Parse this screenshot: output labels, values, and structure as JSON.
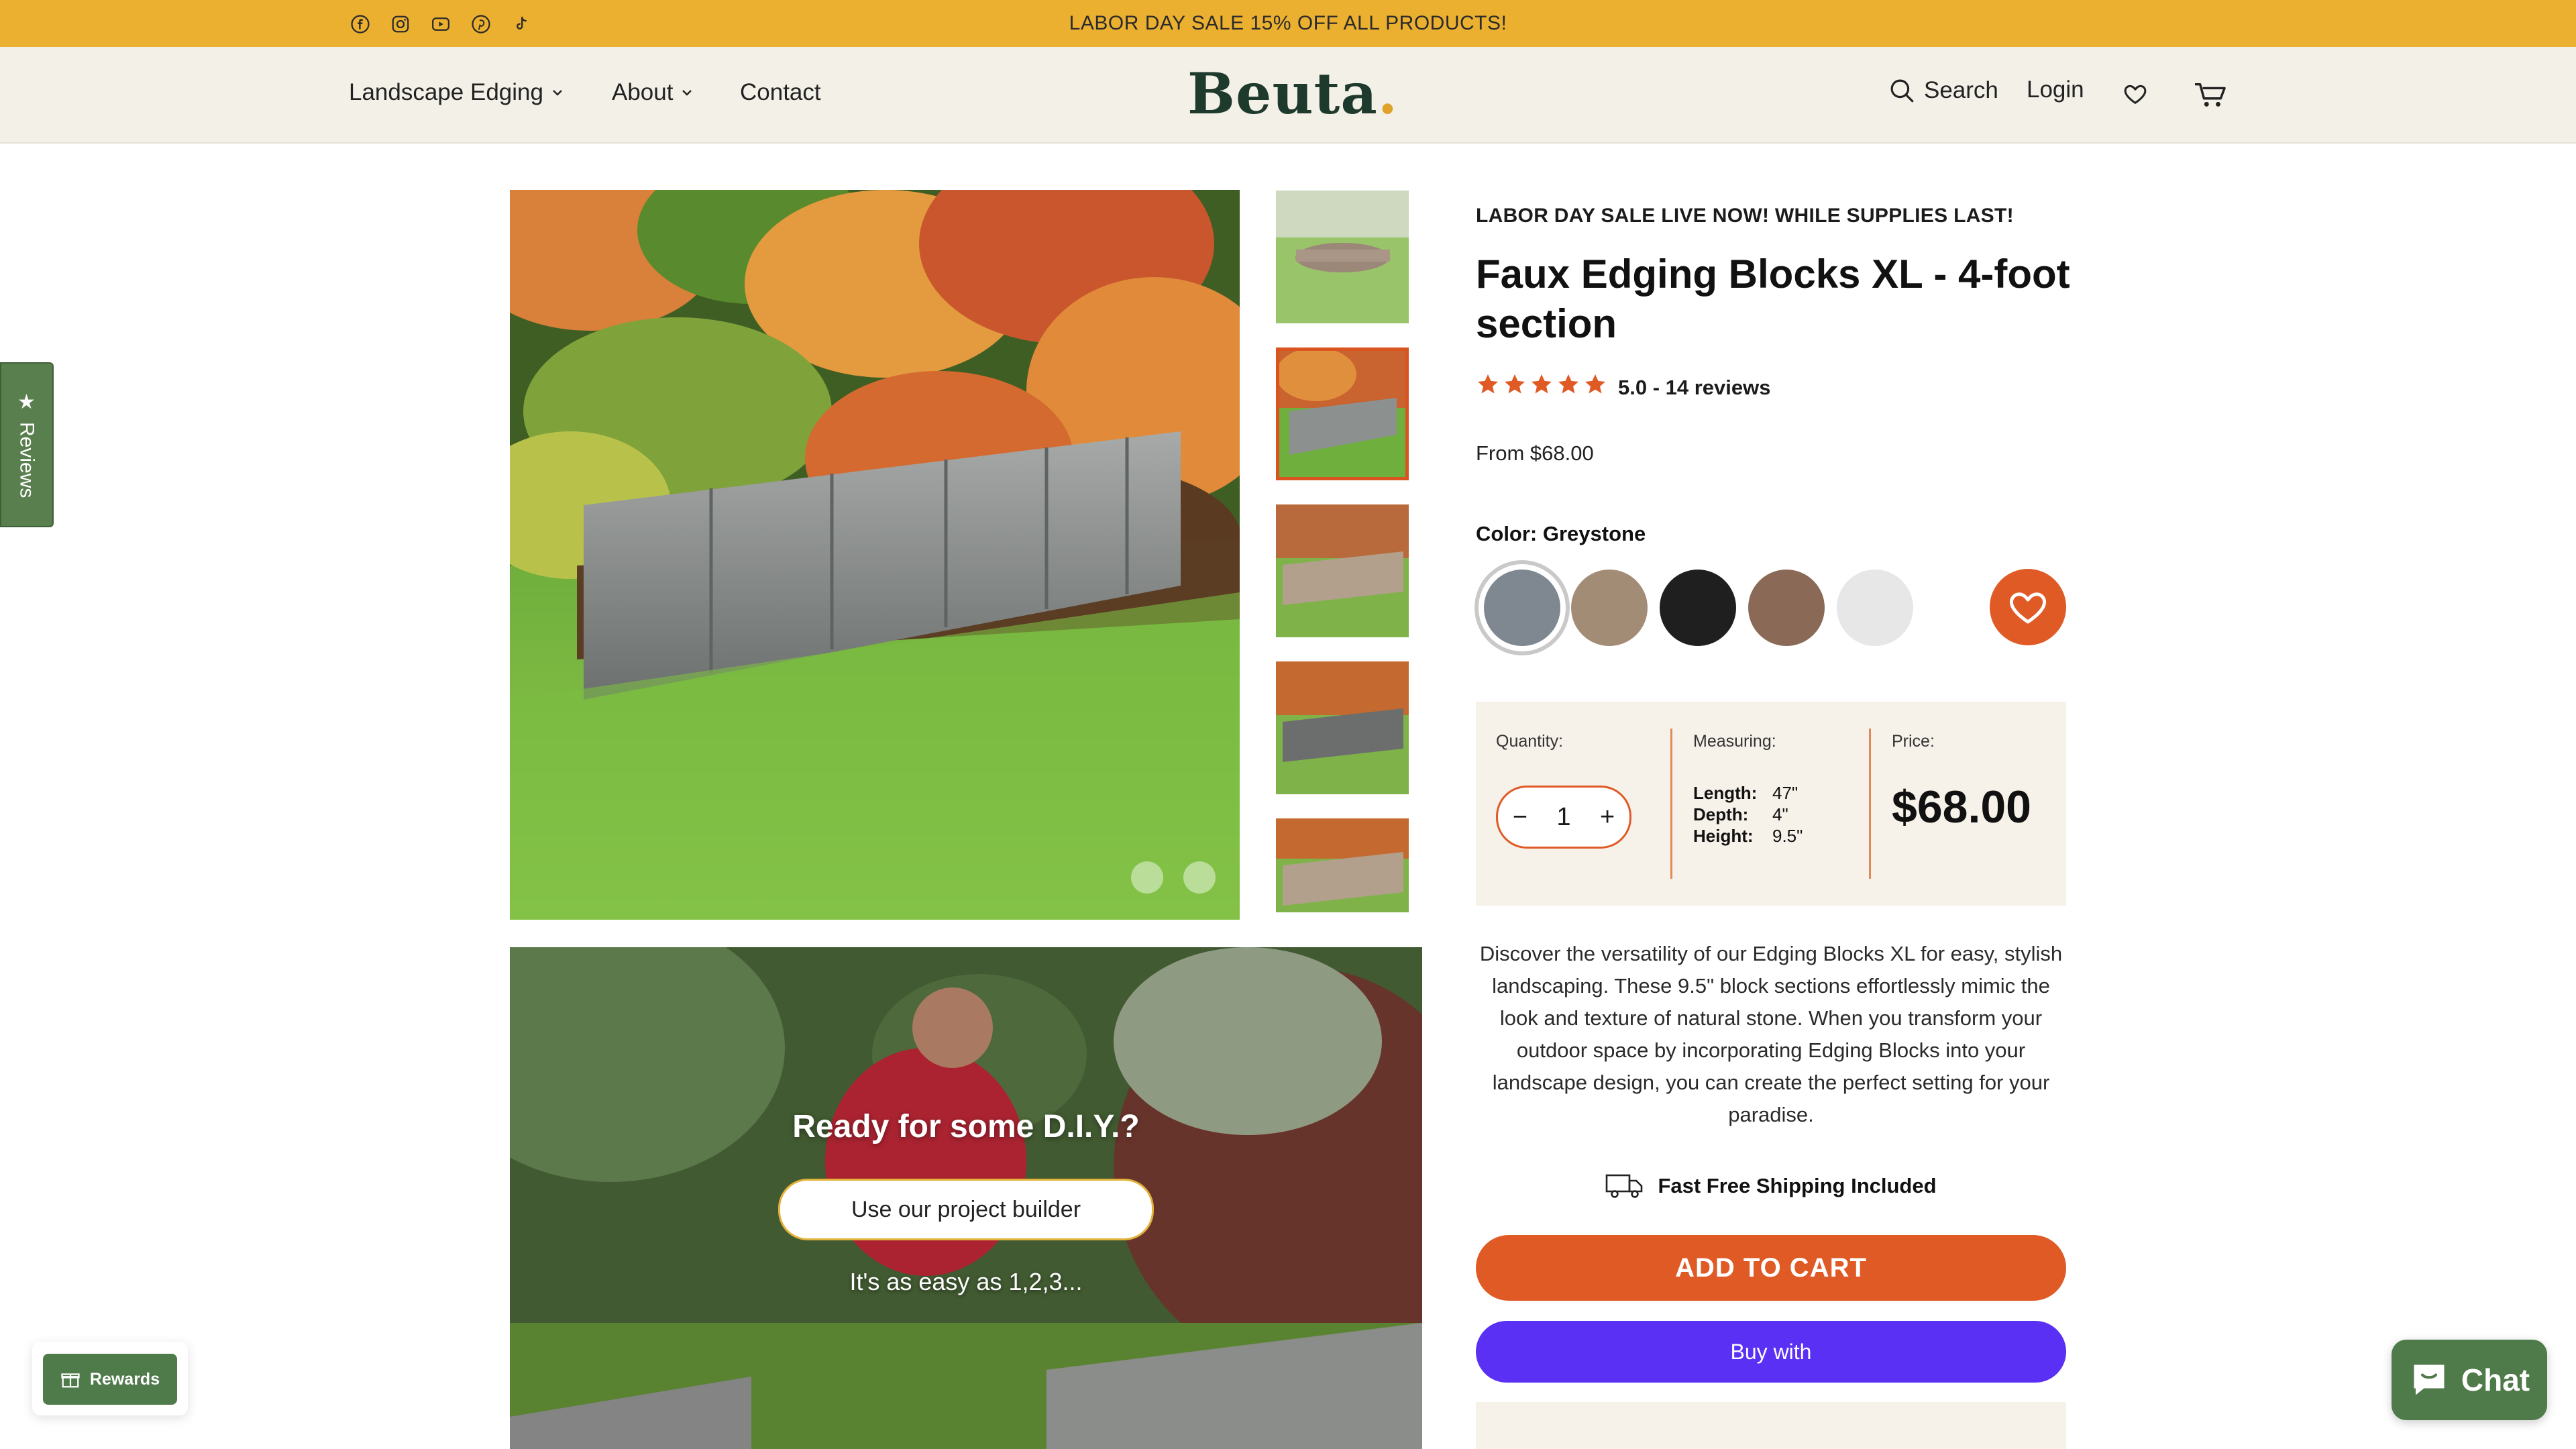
{
  "announcement": {
    "text": "LABOR DAY SALE 15% OFF ALL PRODUCTS!"
  },
  "social_icons": [
    "facebook-icon",
    "instagram-icon",
    "youtube-icon",
    "pinterest-icon",
    "tiktok-icon"
  ],
  "nav": {
    "landscape_edging": "Landscape Edging",
    "about": "About",
    "contact": "Contact"
  },
  "brand": {
    "name": "Beut",
    "last_letter": "a"
  },
  "header_right": {
    "search": "Search",
    "login": "Login"
  },
  "reviews_tab": {
    "label": "Reviews"
  },
  "gallery": {
    "thumbnail_count": 5,
    "selected_index": 1
  },
  "promo": {
    "title": "Ready for some D.I.Y.?",
    "button": "Use our project builder",
    "subtitle": "It's as easy as 1,2,3..."
  },
  "product": {
    "sale_banner": "LABOR DAY SALE LIVE NOW! WHILE SUPPLIES LAST!",
    "title": "Faux Edging Blocks XL - 4-foot section",
    "rating": 5.0,
    "rating_text": "5.0 - 14 reviews",
    "from_price": "From $68.00",
    "color_label": "Color: Greystone",
    "swatches": [
      {
        "name": "Greystone",
        "color": "#7f8790"
      },
      {
        "name": "Sandstone",
        "color": "#a38c76"
      },
      {
        "name": "Black",
        "color": "#1f1f1f"
      },
      {
        "name": "Brown",
        "color": "#8a6a57"
      },
      {
        "name": "White",
        "color": "#e7e7e7"
      }
    ],
    "quantity_label": "Quantity:",
    "quantity": "1",
    "measuring_label": "Measuring:",
    "measurements": [
      {
        "key": "Length:",
        "value": "47\""
      },
      {
        "key": "Depth:",
        "value": "4\""
      },
      {
        "key": "Height:",
        "value": "9.5\""
      }
    ],
    "price_label": "Price:",
    "price": "$68.00",
    "description": "Discover the versatility of our Edging Blocks XL for easy, stylish landscaping. These 9.5\" block sections effortlessly mimic the look and texture of natural stone. When you transform your outdoor space by incorporating Edging Blocks into your landscape design, you can create the perfect setting for your paradise.",
    "shipping": "Fast Free Shipping Included",
    "add_to_cart": "ADD TO CART",
    "buy_with": "Buy with"
  },
  "widgets": {
    "rewards": "Rewards",
    "chat": "Chat"
  },
  "colors": {
    "accent": "#e05a26",
    "announcement": "#ecb030",
    "header_bg": "#f3f0e7",
    "brand_green": "#4f7a4a",
    "shop_pay": "#5a31f4"
  }
}
